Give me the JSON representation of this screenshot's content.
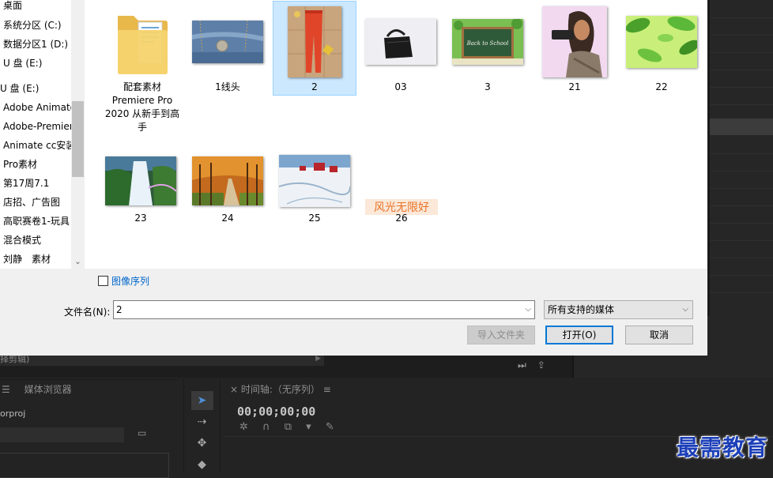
{
  "dialog": {
    "nav_items": [
      {
        "label": "桌面"
      },
      {
        "label": "系统分区 (C:)"
      },
      {
        "label": "数据分区1 (D:)"
      },
      {
        "label": "U 盘 (E:)"
      },
      {
        "label": "U 盘 (E:)"
      },
      {
        "label": "Adobe Animate"
      },
      {
        "label": "Adobe-Premiere"
      },
      {
        "label": "Animate cc安装"
      },
      {
        "label": "Pro素材"
      },
      {
        "label": "第17周7.1"
      },
      {
        "label": "店招、广告图"
      },
      {
        "label": "高职赛卷1-玩具"
      },
      {
        "label": "混合模式"
      },
      {
        "label": "刘静　素材"
      }
    ],
    "files": [
      {
        "name": "配套素材\nPremiere Pro\n2020 从新手到高\n手",
        "kind": "folder"
      },
      {
        "name": "1线头",
        "kind": "jeans"
      },
      {
        "name": "2",
        "kind": "pants",
        "selected": true
      },
      {
        "name": "03",
        "kind": "bag"
      },
      {
        "name": "3",
        "kind": "chalkboard",
        "overlay_text": "Back to School"
      },
      {
        "name": "21",
        "kind": "woman"
      },
      {
        "name": "22",
        "kind": "leaves"
      },
      {
        "name": "23",
        "kind": "waterfall"
      },
      {
        "name": "24",
        "kind": "autumn"
      },
      {
        "name": "25",
        "kind": "snow"
      },
      {
        "name": "26",
        "kind": "text",
        "overlay_text": "风光无限好"
      }
    ],
    "image_sequence_label": "图像序列",
    "filename_label": "文件名(N):",
    "filename_value": "2",
    "filter_value": "所有支持的媒体",
    "import_folder_label": "导入文件夹",
    "open_label": "打开(O)",
    "cancel_label": "取消"
  },
  "premiere": {
    "subbar_text": "择剪辑)",
    "media_browser_tab": "媒体浏览器",
    "project_file": "orproj",
    "timeline_title": "时间轴:（无序列）",
    "timecode": "00;00;00;00"
  },
  "watermark": "最需教育"
}
